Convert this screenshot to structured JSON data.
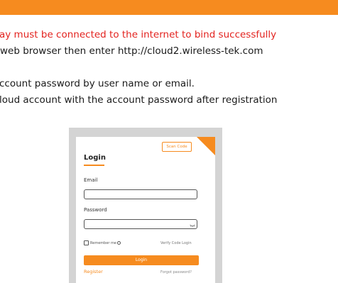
{
  "colors": {
    "accent": "#f68b1f",
    "warning": "#e3231f",
    "frame": "#d4d4d4"
  },
  "doc": {
    "warning_line": "ay must be connected to the internet to bind successfully",
    "line_browser": "web browser then enter http://cloud2.wireless-tek.com",
    "line_password": "ccount password by user name or email.",
    "line_login": "loud account with the account password after registration"
  },
  "login_card": {
    "scan_code_label": "Scan Code",
    "title": "Login",
    "email_label": "Email",
    "email_value": "",
    "password_label": "Password",
    "password_value": "",
    "remember_label": "Remember me",
    "verify_link": "Verify Code Login",
    "login_button": "Login",
    "register_link": "Register",
    "forgot_link": "Forgot password?",
    "icons": {
      "password_toggle": "eye-closed-icon",
      "remember_info": "info-icon"
    }
  }
}
